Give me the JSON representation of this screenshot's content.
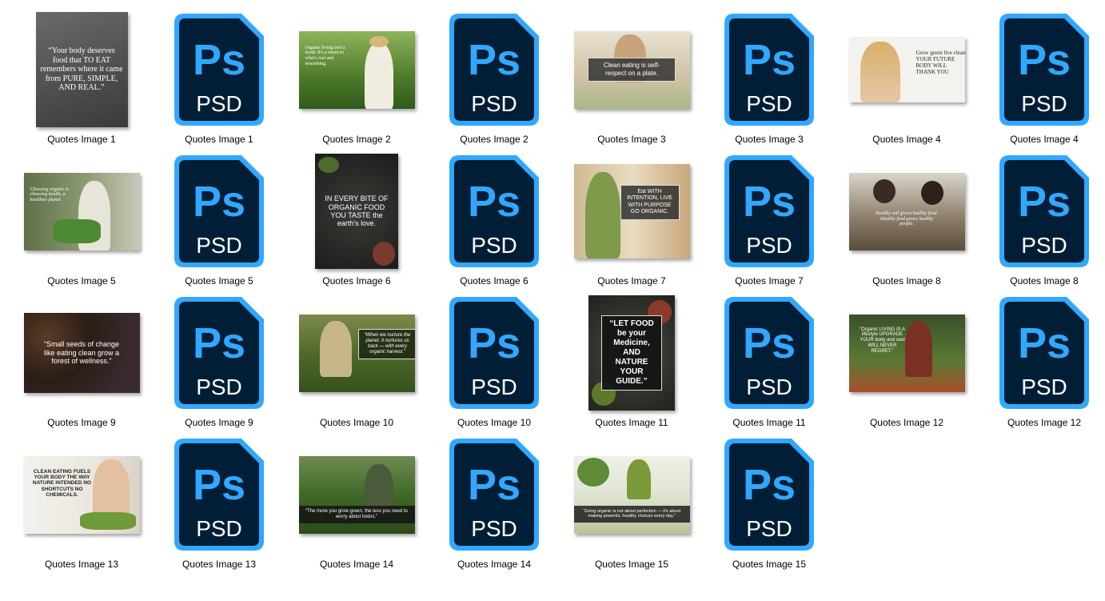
{
  "colors": {
    "psd_border": "#31a8ff",
    "psd_bg": "#001e36",
    "psd_text": "#31a8ff",
    "label_text": "#000000",
    "background": "#ffffff"
  },
  "psd_icon": {
    "logo": "Ps",
    "ext": "PSD",
    "icon": "photoshop-psd-icon"
  },
  "items": [
    {
      "label": "Quotes Image 1",
      "type": "image",
      "quote": "“Your body deserves food that TO EAT remembers where it came from PURE, SIMPLE, AND REAL.”"
    },
    {
      "label": "Quotes Image 1",
      "type": "psd"
    },
    {
      "label": "Quotes Image 2",
      "type": "image",
      "quote": "Organic living isn't a trend. It's a return to what's real and nourishing."
    },
    {
      "label": "Quotes Image 2",
      "type": "psd"
    },
    {
      "label": "Quotes Image 3",
      "type": "image",
      "quote": "Clean eating is self-respect on a plate."
    },
    {
      "label": "Quotes Image 3",
      "type": "psd"
    },
    {
      "label": "Quotes Image 4",
      "type": "image",
      "quote": "Grow green live clean YOUR FUTURE BODY WILL THANK YOU"
    },
    {
      "label": "Quotes Image 4",
      "type": "psd"
    },
    {
      "label": "Quotes Image 5",
      "type": "image",
      "quote": "Choosing organic is choosing health, a healthier planet."
    },
    {
      "label": "Quotes Image 5",
      "type": "psd"
    },
    {
      "label": "Quotes Image 6",
      "type": "image",
      "quote": "IN EVERY BITE OF ORGANIC FOOD YOU TASTE the earth's love."
    },
    {
      "label": "Quotes Image 6",
      "type": "psd"
    },
    {
      "label": "Quotes Image 7",
      "type": "image",
      "quote": "Eat WITH INTENTION, LIVE WITH PURPOSE GO ORGANIC."
    },
    {
      "label": "Quotes Image 7",
      "type": "psd"
    },
    {
      "label": "Quotes Image 8",
      "type": "image",
      "quote": "Healthy soil grows healthy food. Healthy food grows healthy people."
    },
    {
      "label": "Quotes Image 8",
      "type": "psd"
    },
    {
      "label": "Quotes Image 9",
      "type": "image",
      "quote": "“Small seeds of change like eating clean grow a forest of wellness.”"
    },
    {
      "label": "Quotes Image 9",
      "type": "psd"
    },
    {
      "label": "Quotes Image 10",
      "type": "image",
      "quote": "“When we nurture the planet, it nurtures us back — with every organic harvest.”"
    },
    {
      "label": "Quotes Image 10",
      "type": "psd"
    },
    {
      "label": "Quotes Image 11",
      "type": "image",
      "quote": "“LET FOOD be your Medicine, AND NATURE YOUR GUIDE.”"
    },
    {
      "label": "Quotes Image 11",
      "type": "psd"
    },
    {
      "label": "Quotes Image 12",
      "type": "image",
      "quote": "“Organic LIVING IS A lifestyle UPGRADE YOUR body and soul WILL NEVER REGRET.”"
    },
    {
      "label": "Quotes Image 12",
      "type": "psd"
    },
    {
      "label": "Quotes Image 13",
      "type": "image",
      "quote": "CLEAN EATING FUELS YOUR BODY THE WAY NATURE INTENDED NO SHORTCUTS NO CHEMICALS."
    },
    {
      "label": "Quotes Image 13",
      "type": "psd"
    },
    {
      "label": "Quotes Image 14",
      "type": "image",
      "quote": "“The more you grow green, the less you need to worry about toxins.”"
    },
    {
      "label": "Quotes Image 14",
      "type": "psd"
    },
    {
      "label": "Quotes Image 15",
      "type": "image",
      "quote": "“Going organic is not about perfection — it's about making powerful, healthy choices every day.”"
    },
    {
      "label": "Quotes Image 15",
      "type": "psd"
    }
  ]
}
